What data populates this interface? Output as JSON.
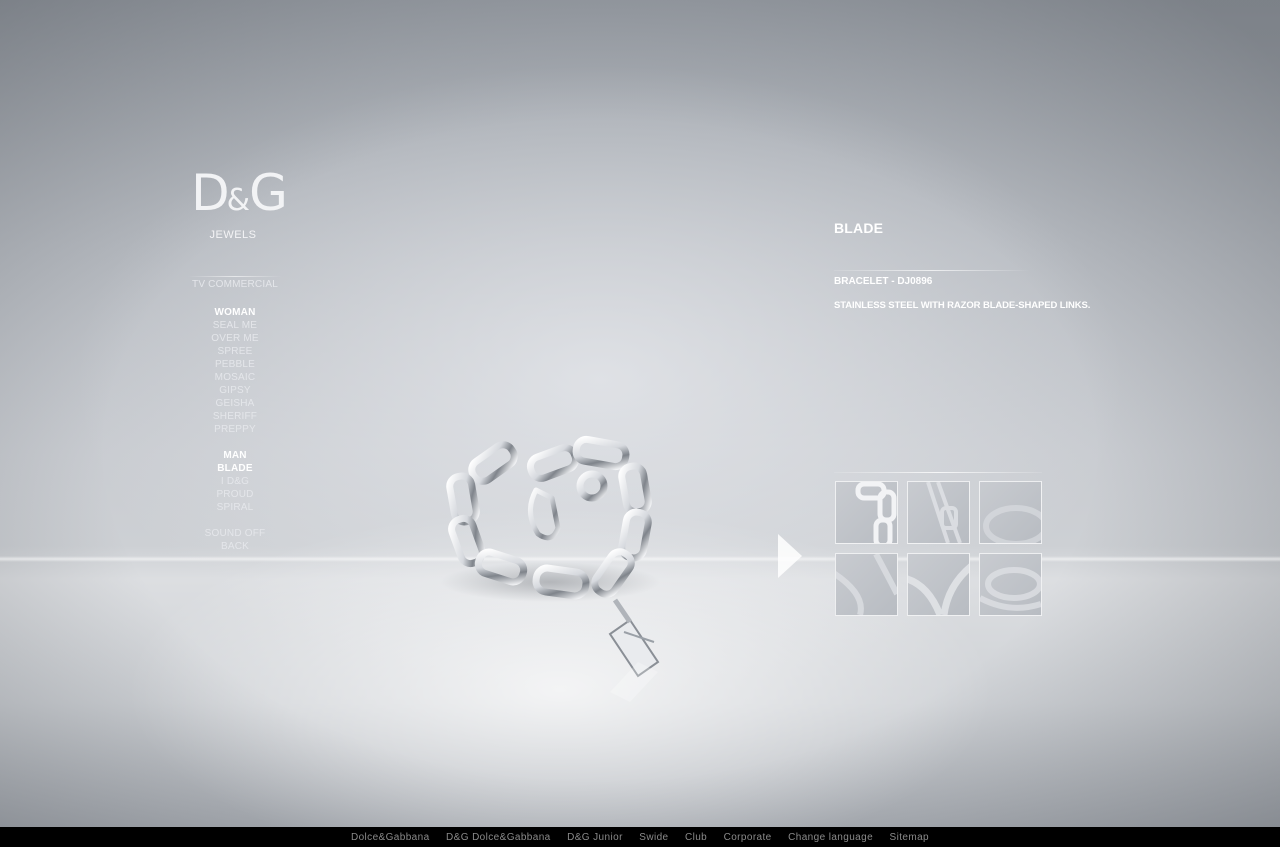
{
  "brand": {
    "logo_text": "D&G",
    "logo_sub": "JEWELS"
  },
  "nav": {
    "tv_commercial": "TV COMMERCIAL",
    "woman": {
      "heading": "WOMAN",
      "items": [
        "SEAL ME",
        "OVER ME",
        "SPREE",
        "PEBBLE",
        "MOSAIC",
        "GIPSY",
        "GEISHA",
        "SHERIFF",
        "PREPPY"
      ]
    },
    "man": {
      "heading": "MAN",
      "items": [
        "BLADE",
        "I D&G",
        "PROUD",
        "SPIRAL"
      ],
      "active": "BLADE"
    },
    "sound_off": "SOUND OFF",
    "back": "BACK"
  },
  "product": {
    "collection": "BLADE",
    "code": "BRACELET -  DJ0896",
    "description": "STAINLESS STEEL WITH RAZOR BLADE-SHAPED LINKS."
  },
  "next_arrow_icon": "play-arrow-icon",
  "thumbnails": [
    "thumbnail-1",
    "thumbnail-2",
    "thumbnail-3",
    "thumbnail-4",
    "thumbnail-5",
    "thumbnail-6"
  ],
  "footer": {
    "links": [
      "Dolce&Gabbana",
      "D&G Dolce&Gabbana",
      "D&G Junior",
      "Swide",
      "Club",
      "Corporate",
      "Change language",
      "Sitemap"
    ]
  },
  "colors": {
    "text": "#ffffff",
    "footer_bg": "#000000",
    "footer_text": "#8a8a8a"
  }
}
